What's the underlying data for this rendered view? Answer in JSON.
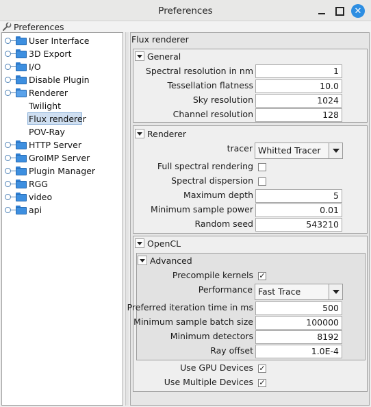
{
  "window": {
    "title": "Preferences"
  },
  "header": {
    "label": "Preferences",
    "icon": "wrench-icon"
  },
  "tree": {
    "items": [
      {
        "label": "User Interface",
        "type": "folder"
      },
      {
        "label": "3D Export",
        "type": "folder"
      },
      {
        "label": "I/O",
        "type": "folder"
      },
      {
        "label": "Disable Plugin",
        "type": "folder"
      },
      {
        "label": "Renderer",
        "type": "folder-open"
      },
      {
        "label": "Twilight",
        "type": "leaf"
      },
      {
        "label": "Flux renderer",
        "type": "leaf",
        "selected": true
      },
      {
        "label": "POV-Ray",
        "type": "leaf"
      },
      {
        "label": "HTTP Server",
        "type": "folder"
      },
      {
        "label": "GroIMP Server",
        "type": "folder"
      },
      {
        "label": "Plugin Manager",
        "type": "folder"
      },
      {
        "label": "RGG",
        "type": "folder"
      },
      {
        "label": "video",
        "type": "folder"
      },
      {
        "label": "api",
        "type": "folder"
      }
    ]
  },
  "panel": {
    "title": "Flux renderer",
    "general": {
      "label": "General",
      "spectral_resolution_label": "Spectral resolution in nm",
      "spectral_resolution_value": "1",
      "tessellation_label": "Tessellation flatness",
      "tessellation_value": "10.0",
      "sky_label": "Sky resolution",
      "sky_value": "1024",
      "channel_label": "Channel resolution",
      "channel_value": "128"
    },
    "renderer": {
      "label": "Renderer",
      "tracer_label": "tracer",
      "tracer_value": "Whitted Tracer",
      "full_spectral_label": "Full spectral rendering",
      "full_spectral_checked": false,
      "spectral_dispersion_label": "Spectral dispersion",
      "spectral_dispersion_checked": false,
      "max_depth_label": "Maximum depth",
      "max_depth_value": "5",
      "min_sample_power_label": "Minimum sample power",
      "min_sample_power_value": "0.01",
      "random_seed_label": "Random seed",
      "random_seed_value": "543210"
    },
    "opencl": {
      "label": "OpenCL",
      "advanced": {
        "label": "Advanced",
        "precompile_label": "Precompile kernels",
        "precompile_checked": true,
        "performance_label": "Performance",
        "performance_value": "Fast Trace",
        "iteration_time_label": "Preferred iteration time in ms",
        "iteration_time_value": "500",
        "min_batch_label": "Minimum sample batch size",
        "min_batch_value": "100000",
        "min_detectors_label": "Minimum detectors",
        "min_detectors_value": "8192",
        "ray_offset_label": "Ray offset",
        "ray_offset_value": "1.0E-4"
      },
      "gpu_label": "Use GPU Devices",
      "gpu_checked": true,
      "multiple_label": "Use Multiple Devices",
      "multiple_checked": true
    }
  },
  "colors": {
    "accent": "#2d8ee2",
    "folder": "#3d8fe0",
    "selection": "#cfdff1"
  }
}
